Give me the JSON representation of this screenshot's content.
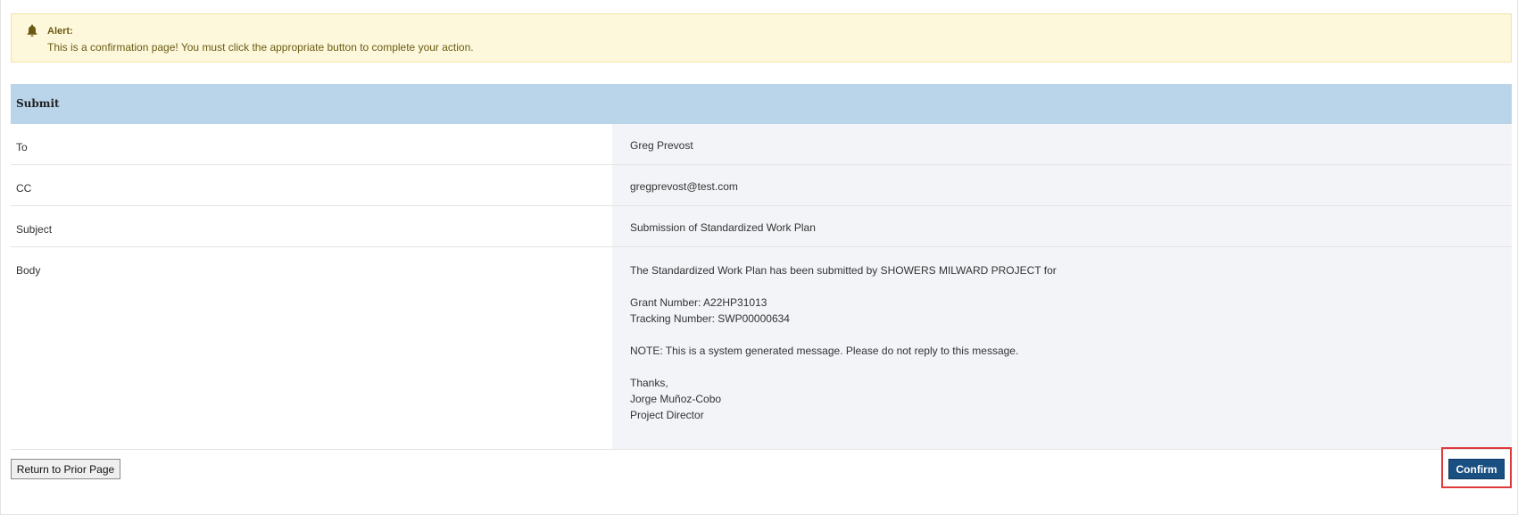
{
  "alert": {
    "icon": "bell-icon",
    "title": "Alert:",
    "message": "This is a confirmation page! You must click the appropriate button to complete your action.",
    "color": "#6b5a12",
    "background": "#fdf8dc"
  },
  "panel": {
    "title": "Submit",
    "header_color": "#bad5ea"
  },
  "fields": {
    "to": {
      "label": "To",
      "value": "Greg Prevost"
    },
    "cc": {
      "label": "CC",
      "value": "gregprevost@test.com"
    },
    "subject": {
      "label": "Subject",
      "value": "Submission of Standardized Work Plan"
    },
    "body": {
      "label": "Body",
      "lines": {
        "intro": "The Standardized Work Plan has been submitted by SHOWERS MILWARD PROJECT for",
        "grant": "Grant Number: A22HP31013",
        "tracking": "Tracking Number: SWP00000634",
        "note": "NOTE: This is a system generated message. Please do not reply to this message.",
        "thanks": "Thanks,",
        "name": "Jorge Muñoz-Cobo",
        "role": "Project Director"
      }
    }
  },
  "actions": {
    "return_label": "Return to Prior Page",
    "confirm_label": "Confirm",
    "confirm_color": "#1a4f82",
    "highlight_color": "#e0393b"
  }
}
